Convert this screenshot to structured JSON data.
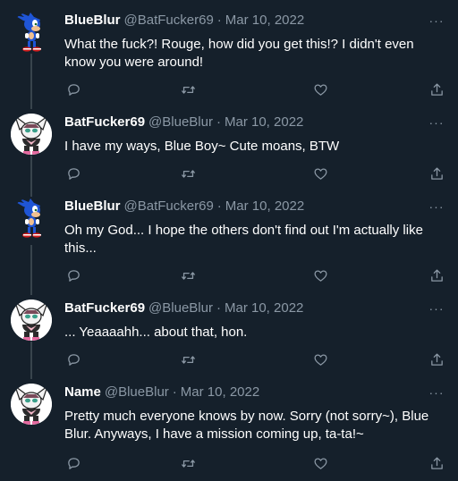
{
  "colors": {
    "background": "#15202b",
    "text_primary": "#ffffff",
    "text_secondary": "#8b98a5",
    "thread_line": "#38444d"
  },
  "more_label": "···",
  "tweets": [
    {
      "display_name": "BlueBlur",
      "handle": "@BatFucker69",
      "separator": "·",
      "date": "Mar 10, 2022",
      "text": "What the fuck?! Rouge, how did you get this!? I didn't even know you were around!",
      "avatar": "sonic-avatar",
      "icons": [
        "reply-icon",
        "retweet-icon",
        "like-icon",
        "share-icon"
      ]
    },
    {
      "display_name": "BatFucker69",
      "handle": "@BlueBlur",
      "separator": "·",
      "date": "Mar 10, 2022",
      "text": "I have my ways, Blue Boy~ Cute moans, BTW",
      "avatar": "rouge-avatar",
      "icons": [
        "reply-icon",
        "retweet-icon",
        "like-icon",
        "share-icon"
      ]
    },
    {
      "display_name": "BlueBlur",
      "handle": "@BatFucker69",
      "separator": "·",
      "date": "Mar 10, 2022",
      "text": "Oh my God... I hope the others don't find out I'm actually like this...",
      "avatar": "sonic-avatar",
      "icons": [
        "reply-icon",
        "retweet-icon",
        "like-icon",
        "share-icon"
      ]
    },
    {
      "display_name": "BatFucker69",
      "handle": "@BlueBlur",
      "separator": "·",
      "date": "Mar 10, 2022",
      "text": "... Yeaaaahh... about that, hon.",
      "avatar": "rouge-avatar",
      "icons": [
        "reply-icon",
        "retweet-icon",
        "like-icon",
        "share-icon"
      ]
    },
    {
      "display_name": "Name",
      "handle": "@BlueBlur",
      "separator": "·",
      "date": "Mar 10, 2022",
      "text": "Pretty much everyone knows by now. Sorry (not sorry~), Blue Blur. Anyways, I have a mission coming up, ta-ta!~",
      "avatar": "rouge-avatar",
      "icons": [
        "reply-icon",
        "retweet-icon",
        "like-icon",
        "share-icon"
      ]
    }
  ]
}
